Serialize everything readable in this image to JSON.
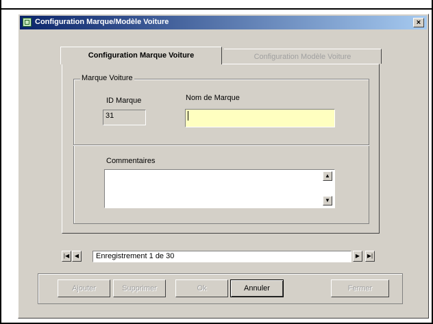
{
  "window": {
    "title": "Configuration Marque/Modèle Voiture",
    "close_label": "×"
  },
  "tabs": [
    {
      "label": "Configuration Marque Voiture",
      "active": true
    },
    {
      "label": "Configuration Modèle Voiture",
      "active": false
    }
  ],
  "group": {
    "label": "Marque Voiture",
    "id_label": "ID Marque",
    "id_value": "31",
    "name_label": "Nom de Marque",
    "name_value": "",
    "comments_label": "Commentaires",
    "comments_value": ""
  },
  "navigator": {
    "first": "|◀",
    "prev": "◀",
    "record_text": "Enregistrement 1 de 30",
    "next": "▶",
    "last": "▶|"
  },
  "buttons": {
    "ajouter": "Ajouter",
    "supprimer": "Supprimer",
    "ok": "Ok",
    "annuler": "Annuler",
    "fermer": "Fermer"
  },
  "colors": {
    "titlebar_start": "#0a246a",
    "titlebar_end": "#a6caf0",
    "required_field": "#ffffc0"
  }
}
